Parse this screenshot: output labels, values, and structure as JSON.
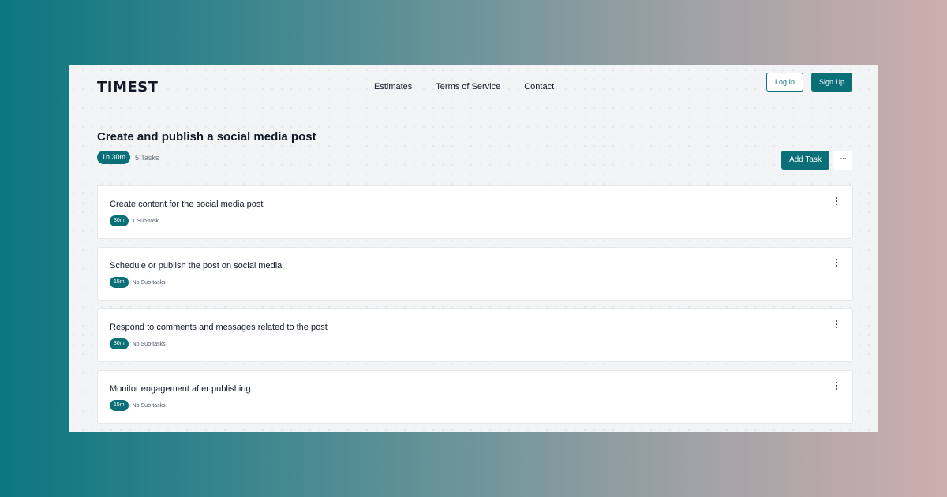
{
  "app": {
    "logo": "TIMEST"
  },
  "nav": {
    "links": [
      "Estimates",
      "Terms of Service",
      "Contact"
    ],
    "login_label": "Log In",
    "signup_label": "Sign Up"
  },
  "project": {
    "title": "Create and publish a social media post",
    "duration": "1h 30m",
    "task_count": "5 Tasks",
    "add_task_label": "Add Task",
    "more_label": "···"
  },
  "tasks": [
    {
      "title": "Create content for the social media post",
      "duration": "30m",
      "subtasks": "1 Sub-task"
    },
    {
      "title": "Schedule or publish the post on social media",
      "duration": "15m",
      "subtasks": "No Sub-tasks"
    },
    {
      "title": "Respond to comments and messages related to the post",
      "duration": "30m",
      "subtasks": "No Sub-tasks"
    },
    {
      "title": "Monitor engagement after publishing",
      "duration": "15m",
      "subtasks": "No Sub-tasks"
    }
  ],
  "colors": {
    "accent": "#0b6f78",
    "page_bg": "#f3f4f6",
    "text": "#111827"
  }
}
